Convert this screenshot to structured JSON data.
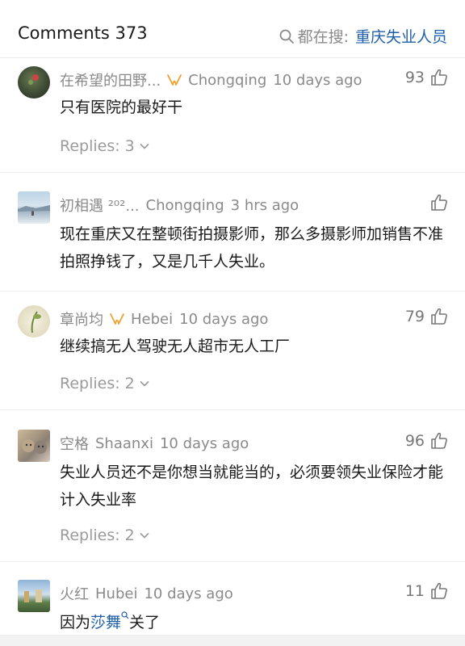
{
  "header": {
    "title": "Comments 373",
    "search_prefix": "都在搜:",
    "search_query": "重庆失业人员"
  },
  "comments": [
    {
      "name": "在希望的田野...",
      "location": "Chongqing",
      "time": "10 days ago",
      "likes": "93",
      "text": "只有医院的最好干",
      "replies": "Replies: 3"
    },
    {
      "name": "初相遇 ²⁰²...",
      "location": "Chongqing",
      "time": "3 hrs ago",
      "likes": "",
      "text": "现在重庆又在整顿街拍摄影师，那么多摄影师加销售不准拍照挣钱了，又是几千人失业。",
      "replies": ""
    },
    {
      "name": "章尚均",
      "location": "Hebei",
      "time": "10 days ago",
      "likes": "79",
      "text": "继续搞无人驾驶无人超市无人工厂",
      "replies": "Replies: 2"
    },
    {
      "name": "空格",
      "location": "Shaanxi",
      "time": "10 days ago",
      "likes": "96",
      "text": "失业人员还不是你想当就能当的，必须要领失业保险才能计入失业率",
      "replies": "Replies: 2"
    },
    {
      "name": "火红",
      "location": "Hubei",
      "time": "10 days ago",
      "likes": "11",
      "text_before": "因为",
      "text_link": "莎舞",
      "text_after": "关了",
      "replies": ""
    }
  ],
  "colors": {
    "link": "#1f5fa8",
    "muted": "#8a8a8a",
    "badge": "#f0a030"
  },
  "icons": [
    "search-icon",
    "badge-icon",
    "thumb-up-icon",
    "chevron-down-icon",
    "search-small-icon"
  ]
}
